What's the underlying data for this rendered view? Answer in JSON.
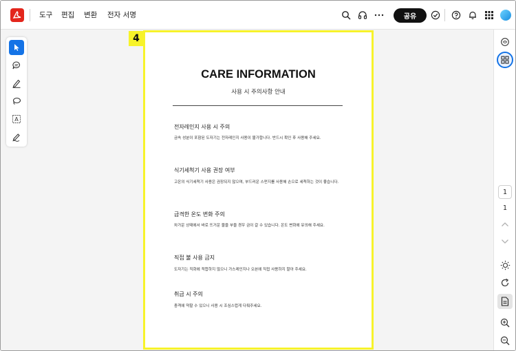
{
  "topbar": {
    "menus": [
      "도구",
      "편집",
      "변환",
      "전자 서명"
    ],
    "share_label": "공유",
    "icons": [
      "search-icon",
      "headphones-icon",
      "more-icon",
      "check-circle-icon",
      "help-icon",
      "bell-icon",
      "apps-grid-icon",
      "profile-icon"
    ]
  },
  "tools": [
    "select-icon",
    "comment-icon",
    "highlight-pen-icon",
    "lasso-icon",
    "text-select-icon",
    "sign-icon"
  ],
  "page": {
    "badge": "4",
    "title": "CARE INFORMATION",
    "subtitle": "사용 시 주의사항 안내",
    "sections": [
      {
        "heading": "전자레인지 사용 시 주의",
        "body": "금속 성분이 포함된 도자기는 전자레인지 사용이 불가합니다. 반드시 확인 후 사용해 주세요."
      },
      {
        "heading": "식기세척기 사용 권장 여부",
        "body": "고온의 식기세척기 사용은 권장되지 않으며, 부드러운 스펀지를 사용해 손으로 세척하는 것이 좋습니다."
      },
      {
        "heading": "급격한 온도 변화 주의",
        "body": "차가운 상태에서 바로 뜨거운 물을 부을 경우 금이 갈 수 있습니다. 온도 변화에 유의해 주세요."
      },
      {
        "heading": "직접 불 사용 금지",
        "body": "도자기는 직화에 적합하지 않으니 가스레인지나 오븐에 직접 사용하지 말아 주세요."
      },
      {
        "heading": "취급 시 주의",
        "body": "충격에 약할 수 있으니 사용 시 조심스럽게 다뤄주세요."
      }
    ]
  },
  "rail": {
    "current_page": "1",
    "total_pages": "1",
    "icons": [
      "ai-assistant-icon",
      "thumbnails-icon",
      "page-up-icon",
      "page-down-icon",
      "brightness-icon",
      "rotate-icon",
      "document-icon",
      "zoom-in-icon",
      "zoom-out-icon"
    ]
  },
  "colors": {
    "accent": "#1473e6",
    "selection": "#f7f32a",
    "brand": "#e3261c"
  }
}
